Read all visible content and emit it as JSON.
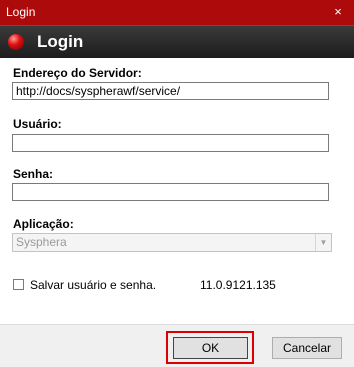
{
  "window": {
    "title": "Login",
    "close_glyph": "×"
  },
  "header": {
    "title": "Login",
    "icon": "red-ball-icon"
  },
  "form": {
    "server_label": "Endereço do Servidor:",
    "server_value": "http://docs/syspherawf/service/",
    "user_label": "Usuário:",
    "user_value": "",
    "password_label": "Senha:",
    "password_value": "",
    "app_label": "Aplicação:",
    "app_value": "Sysphera",
    "save_label": "Salvar usuário e senha.",
    "save_checked": false,
    "version": "11.0.9121.135"
  },
  "buttons": {
    "ok": "OK",
    "cancel": "Cancelar"
  },
  "colors": {
    "titlebar": "#ad0b0b",
    "header": "#2a2a2a",
    "highlight": "#dd0000"
  }
}
